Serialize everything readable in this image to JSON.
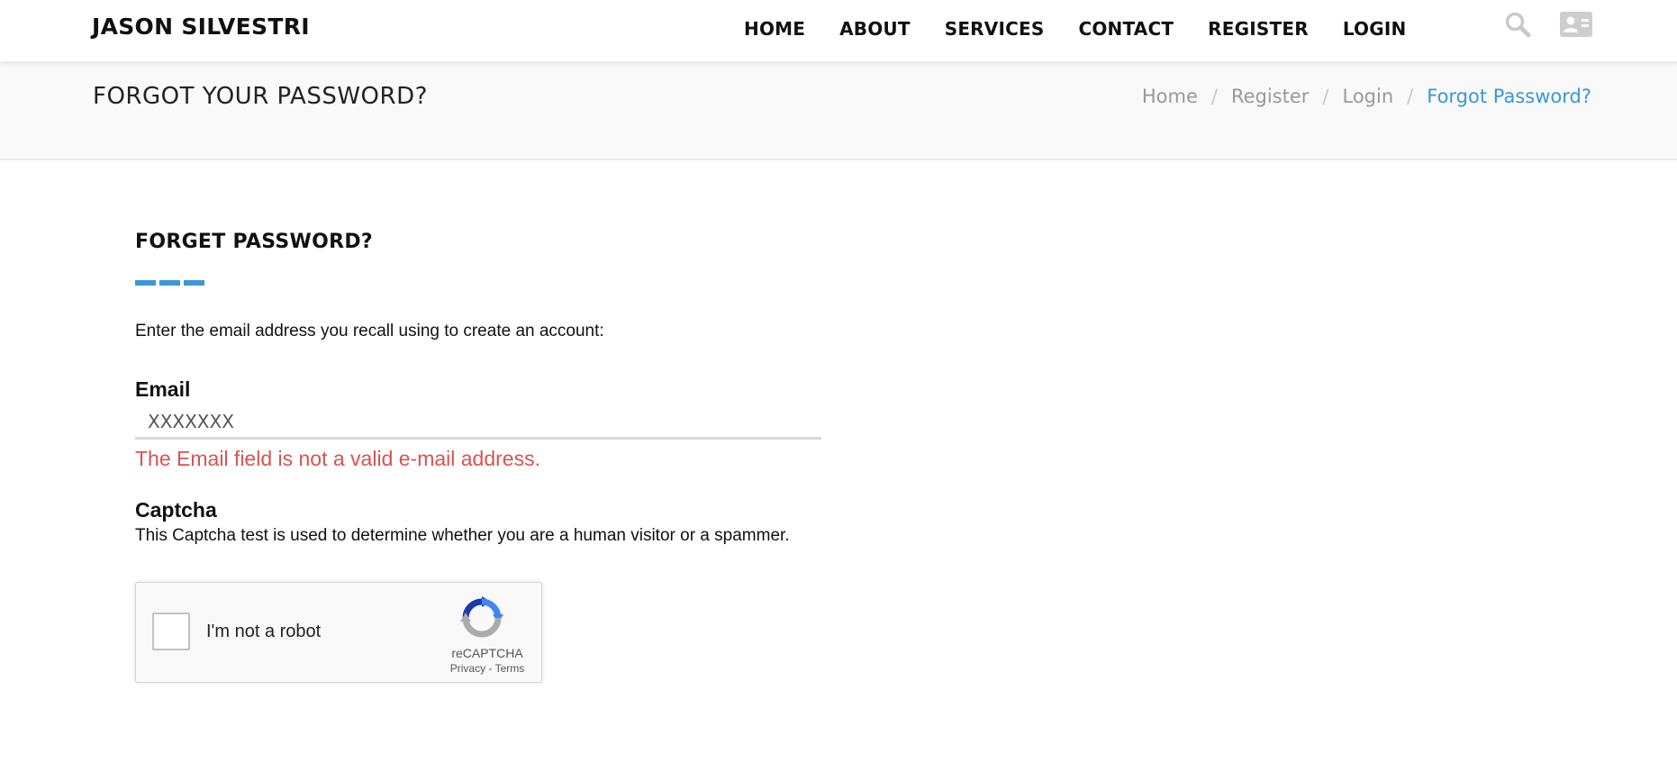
{
  "header": {
    "brand": "JASON SILVESTRI",
    "nav": [
      {
        "label": "HOME"
      },
      {
        "label": "ABOUT"
      },
      {
        "label": "SERVICES"
      },
      {
        "label": "CONTACT"
      },
      {
        "label": "REGISTER"
      },
      {
        "label": "LOGIN"
      }
    ],
    "icons": [
      "search-icon",
      "contact-card-icon"
    ]
  },
  "page_header": {
    "title": "FORGOT YOUR PASSWORD?",
    "breadcrumbs": [
      {
        "label": "Home"
      },
      {
        "label": "Register"
      },
      {
        "label": "Login"
      },
      {
        "label": "Forgot Password?"
      }
    ],
    "separator": "/"
  },
  "form": {
    "heading": "FORGET PASSWORD?",
    "intro": "Enter the email address you recall using to create an account:",
    "email_label": "Email",
    "email_value": "XXXXXXX",
    "email_error": "The Email field is not a valid e-mail address.",
    "captcha_label": "Captcha",
    "captcha_description": "This Captcha test is used to determine whether you are a human visitor or a spammer."
  },
  "recaptcha": {
    "checkbox_label": "I'm not a robot",
    "brand": "reCAPTCHA",
    "privacy": "Privacy",
    "links_separator": "-",
    "terms": "Terms"
  },
  "colors": {
    "accent": "#3a98d6",
    "error": "#d9534f",
    "page_header_bg": "#f9f9f9"
  }
}
